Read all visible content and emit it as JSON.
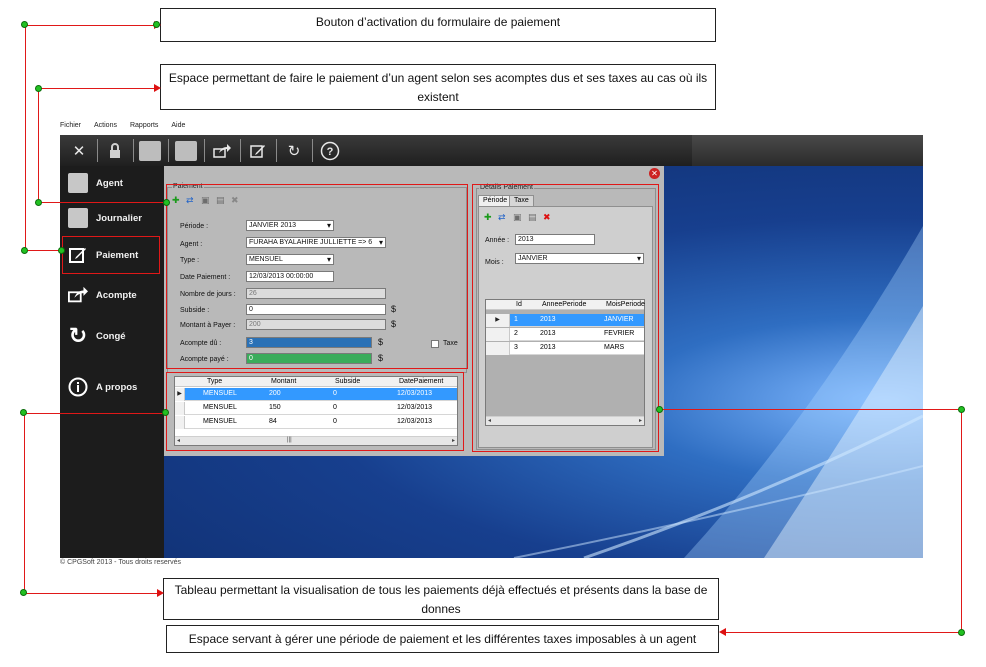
{
  "callouts": {
    "c1": "Bouton d’activation du formulaire de paiement",
    "c2": "Espace permettant de faire le paiement d’un agent selon ses acomptes dus et ses taxes au cas où ils existent",
    "c3": "Tableau permettant la visualisation de tous les paiements déjà effectués et présents dans la base de donnes",
    "c4": "Espace servant à gérer une période de paiement et les différentes taxes imposables à un agent"
  },
  "menu": [
    "Fichier",
    "Actions",
    "Rapports",
    "Aide"
  ],
  "toolbar_icons": [
    "close-icon",
    "lock-icon",
    "user-icon",
    "user-icon",
    "share-icon",
    "edit-icon",
    "refresh-icon",
    "help-icon"
  ],
  "sidebar": {
    "items": [
      {
        "label": "Agent",
        "icon": "user-icon"
      },
      {
        "label": "Journalier",
        "icon": "user-icon"
      },
      {
        "label": "Paiement",
        "icon": "edit-icon"
      },
      {
        "label": "Acompte",
        "icon": "share-icon"
      },
      {
        "label": "Congé",
        "icon": "refresh-icon"
      },
      {
        "label": "A propos",
        "icon": "info-icon"
      }
    ]
  },
  "footer": "© CPGSoft 2013 - Tous droits reservés",
  "paiement": {
    "group_title": "Paiement",
    "labels": {
      "periode": "Période :",
      "agent": "Agent :",
      "type": "Type :",
      "date": "Date Paiement :",
      "jours": "Nombre de jours :",
      "subside": "Subside :",
      "montant": "Montant à Payer :",
      "acompte_du": "Acompte dû :",
      "acompte_paye": "Acompte payé :",
      "taxe": "Taxe"
    },
    "values": {
      "periode": "JANVIER 2013",
      "agent": "FURAHA BYALAHIRE JULLIETTE => 6",
      "type": "MENSUEL",
      "date": "12/03/2013 00:00:00",
      "jours": "26",
      "subside": "0",
      "montant": "200",
      "acompte_du": "3",
      "acompte_paye": "0"
    },
    "currency": "$"
  },
  "payments_table": {
    "columns": [
      "Type",
      "Montant",
      "Subside",
      "DatePaiement"
    ],
    "rows": [
      [
        "MENSUEL",
        "200",
        "0",
        "12/03/2013"
      ],
      [
        "MENSUEL",
        "150",
        "0",
        "12/03/2013"
      ],
      [
        "MENSUEL",
        "84",
        "0",
        "12/03/2013"
      ]
    ]
  },
  "details": {
    "group_title": "Détails Paiement",
    "tabs": [
      "Période",
      "Taxe"
    ],
    "annee_label": "Année :",
    "annee_value": "2013",
    "mois_label": "Mois :",
    "mois_value": "JANVIER",
    "columns": [
      "Id",
      "AnneePeriode",
      "MoisPeriode"
    ],
    "rows": [
      [
        "1",
        "2013",
        "JANVIER"
      ],
      [
        "2",
        "2013",
        "FEVRIER"
      ],
      [
        "3",
        "2013",
        "MARS"
      ]
    ]
  },
  "colors": {
    "accent_red": "#e01818",
    "selection": "#3399ff",
    "dot": "#22c122"
  }
}
